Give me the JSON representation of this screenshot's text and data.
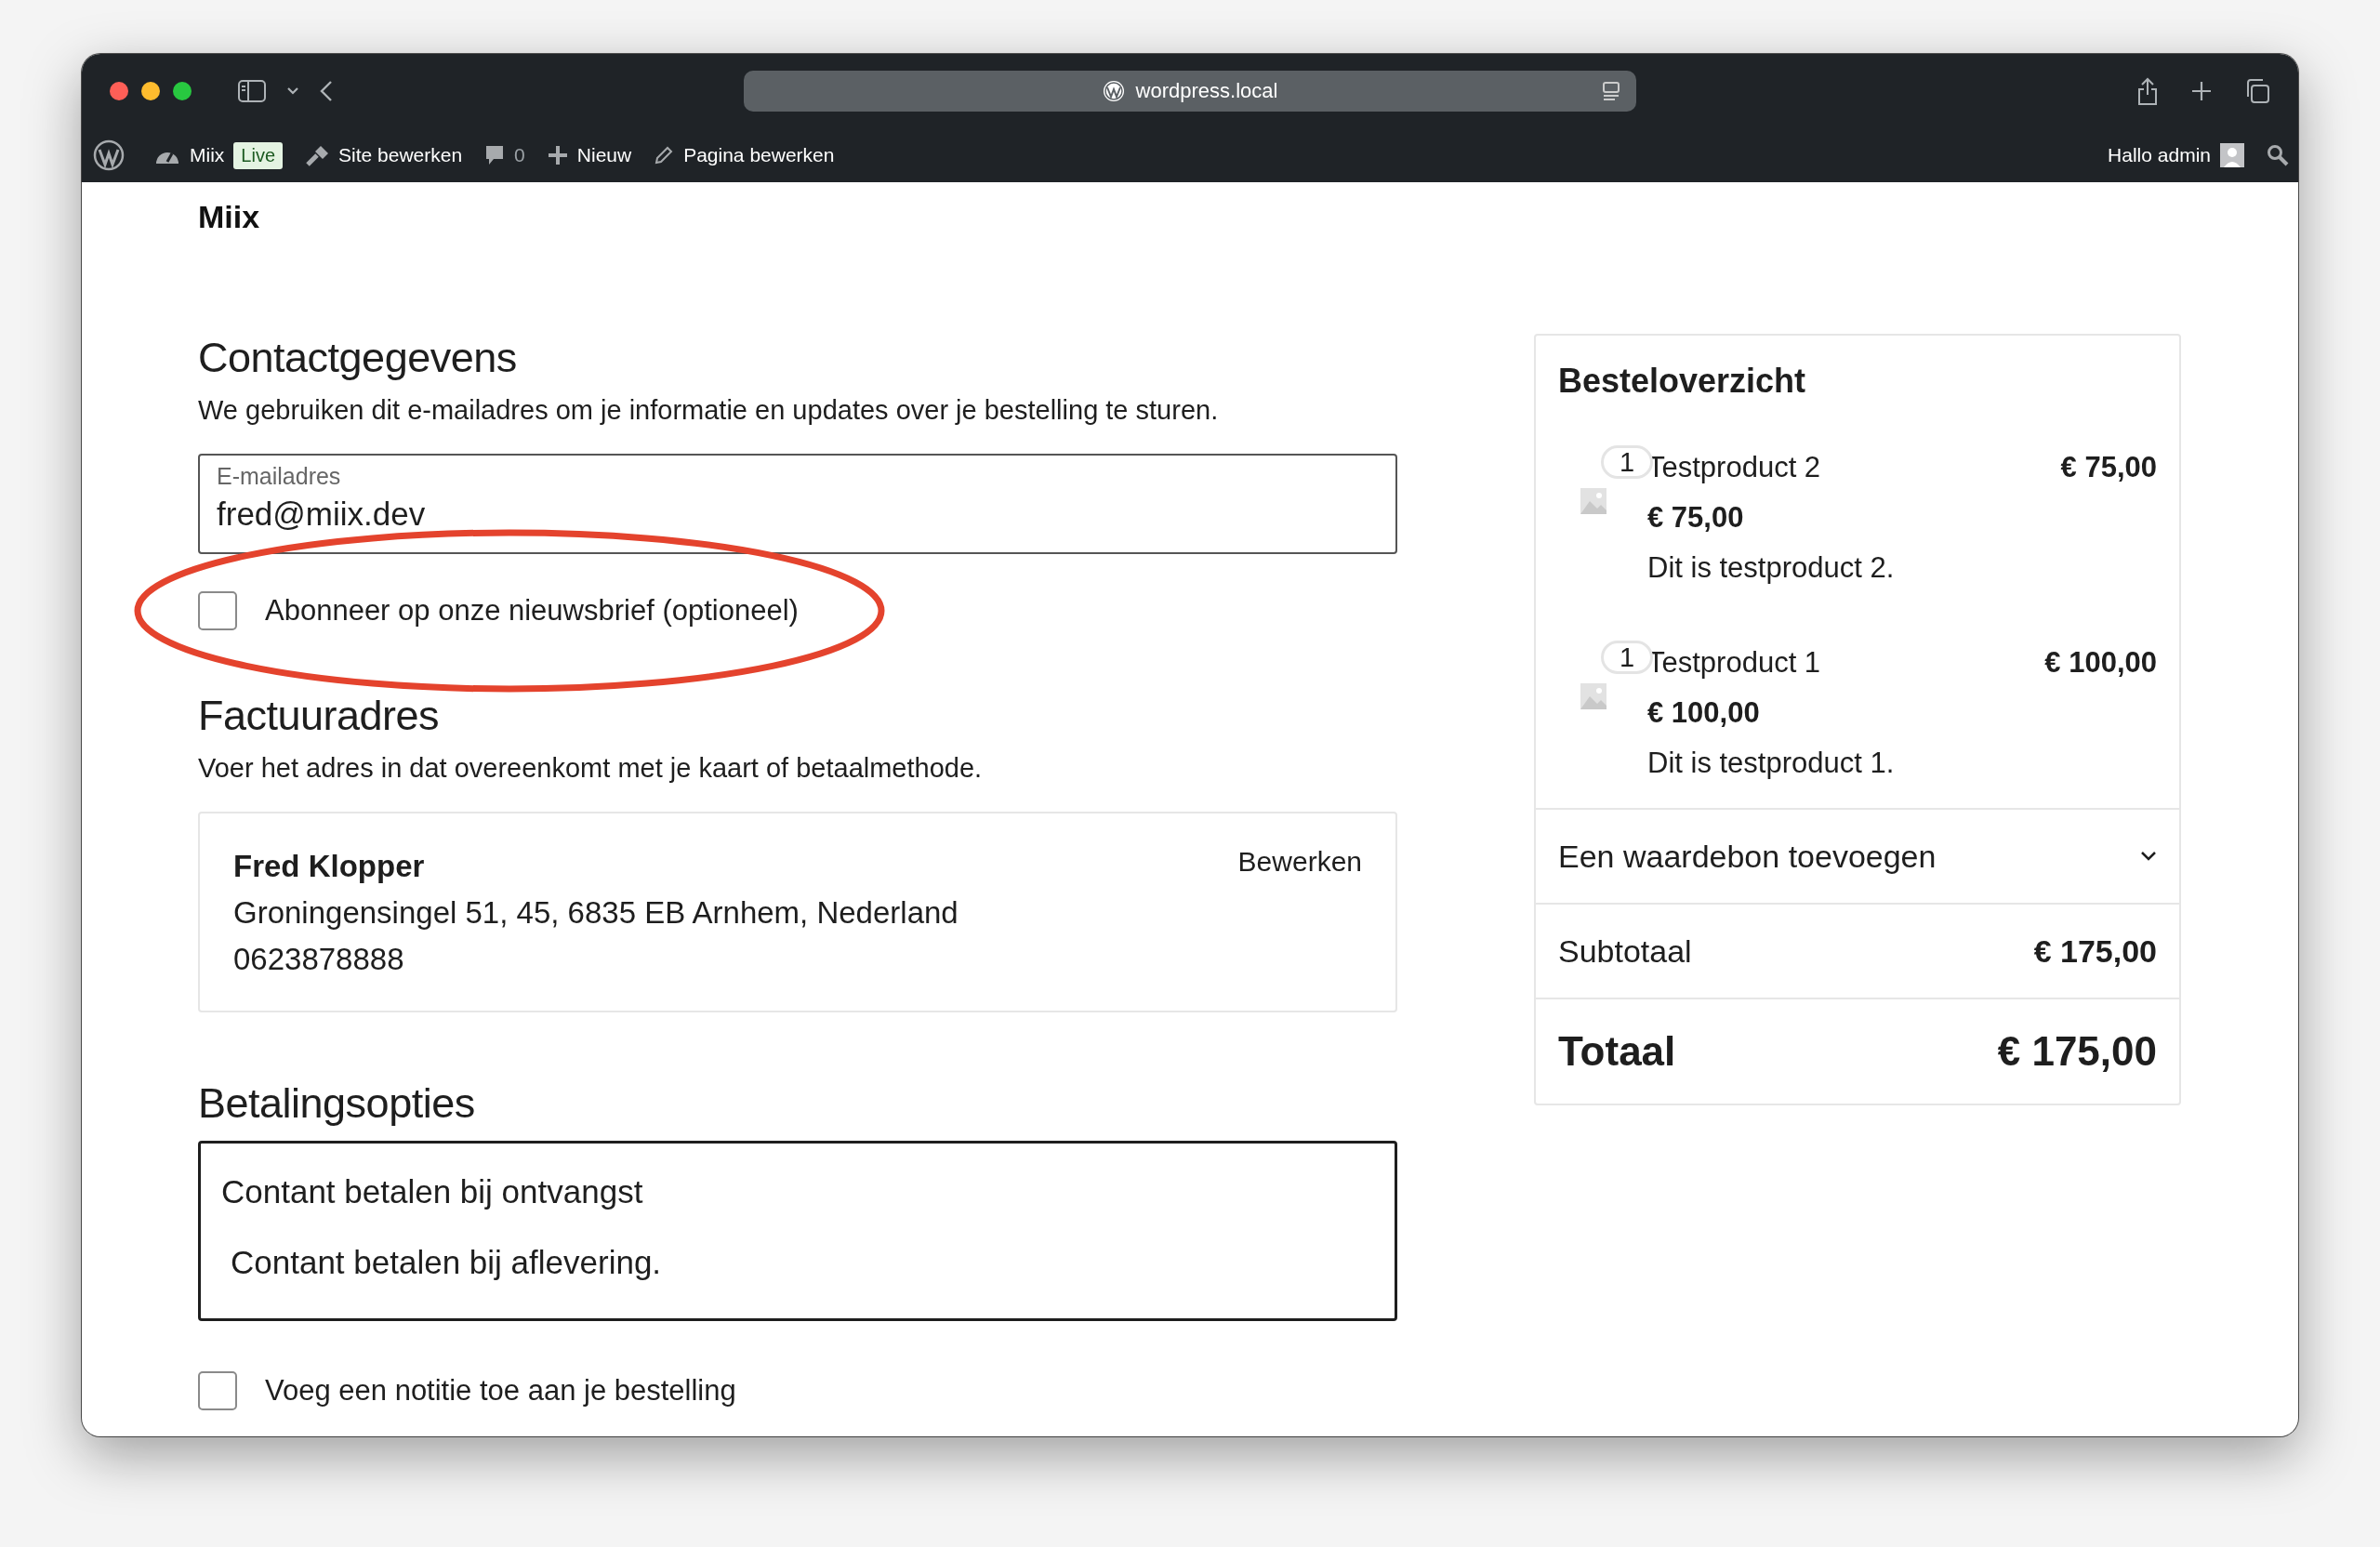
{
  "browser": {
    "url": "wordpress.local"
  },
  "admin_bar": {
    "site": "Miix",
    "badge": "Live",
    "edit_site": "Site bewerken",
    "comments": "0",
    "new_item": "Nieuw",
    "edit_page": "Pagina bewerken",
    "greeting": "Hallo admin"
  },
  "site_title": "Miix",
  "contact": {
    "title": "Contactgegevens",
    "description": "We gebruiken dit e-mailadres om je informatie en updates over je bestelling te sturen.",
    "email": {
      "label": "E-mailadres",
      "value": "fred@miix.dev"
    },
    "newsletter": {
      "label": "Abonneer op onze nieuwsbrief (optioneel)",
      "checked": false
    }
  },
  "billing": {
    "title": "Factuuradres",
    "description": "Voer het adres in dat overeenkomt met je kaart of betaalmethode.",
    "name": "Fred Klopper",
    "address": "Groningensingel 51, 45, 6835 EB Arnhem, Nederland",
    "phone": "0623878888",
    "edit": "Bewerken"
  },
  "payment": {
    "title": "Betalingsopties",
    "options": [
      {
        "label": "Contant betalen bij ontvangst",
        "description": "Contant betalen bij aflevering.",
        "selected": true
      }
    ]
  },
  "note": {
    "label": "Voeg een notitie toe aan je bestelling",
    "checked": false
  },
  "summary": {
    "title": "Besteloverzicht",
    "items": [
      {
        "quantity": "1",
        "name": "Testproduct 2",
        "price": "€ 75,00",
        "unit_price": "€ 75,00",
        "description": "Dit is testproduct 2."
      },
      {
        "quantity": "1",
        "name": "Testproduct 1",
        "price": "€ 100,00",
        "unit_price": "€ 100,00",
        "description": "Dit is testproduct 1."
      }
    ],
    "coupon": {
      "label": "Een waardebon toevoegen",
      "expanded": false
    },
    "subtotal": {
      "label": "Subtotaal",
      "value": "€ 175,00"
    },
    "total": {
      "label": "Totaal",
      "value": "€ 175,00"
    }
  }
}
